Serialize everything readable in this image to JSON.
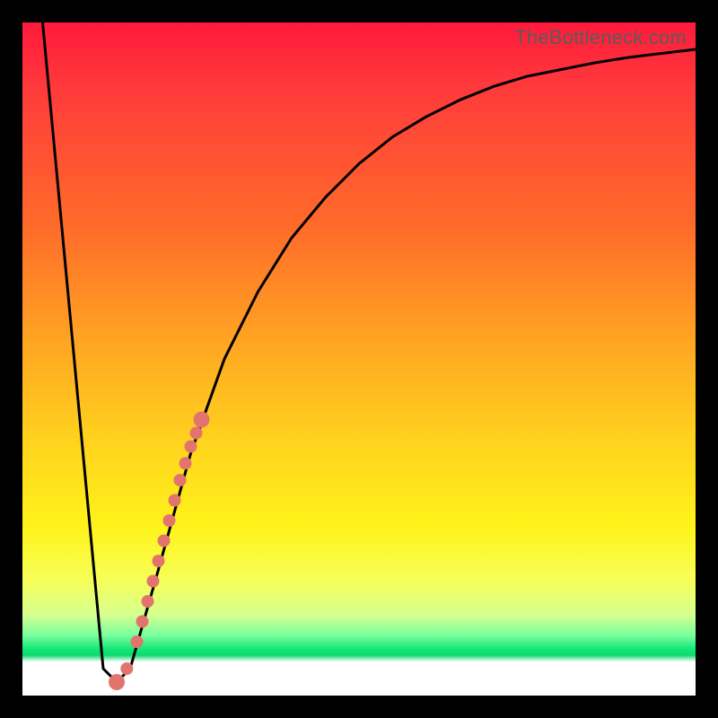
{
  "watermark": "TheBottleneck.com",
  "colors": {
    "frame": "#000000",
    "line": "#000000",
    "dot": "#e2746d",
    "grad_top": "#ff1a3c",
    "grad_mid": "#ffd21e",
    "grad_green": "#18e87a",
    "grad_bottom": "#ffffff"
  },
  "chart_data": {
    "type": "line",
    "title": "",
    "xlabel": "",
    "ylabel": "",
    "xlim": [
      0,
      100
    ],
    "ylim": [
      0,
      100
    ],
    "series": [
      {
        "name": "bottleneck-curve",
        "x": [
          3,
          12,
          14,
          16,
          20,
          25,
          30,
          35,
          40,
          45,
          50,
          55,
          60,
          65,
          70,
          75,
          80,
          85,
          90,
          95,
          100
        ],
        "y": [
          100,
          4,
          2,
          4,
          18,
          36,
          50,
          60,
          68,
          74,
          79,
          83,
          86,
          88.5,
          90.5,
          92,
          93,
          94,
          94.8,
          95.4,
          96
        ]
      }
    ],
    "cluster": {
      "name": "highlighted-points",
      "x": [
        14,
        15.5,
        17,
        17.8,
        18.6,
        19.4,
        20.2,
        21,
        21.8,
        22.6,
        23.4,
        24.2,
        25,
        25.8,
        26.6
      ],
      "y": [
        2,
        4,
        8,
        11,
        14,
        17,
        20,
        23,
        26,
        29,
        32,
        34.5,
        37,
        39,
        41
      ]
    }
  }
}
